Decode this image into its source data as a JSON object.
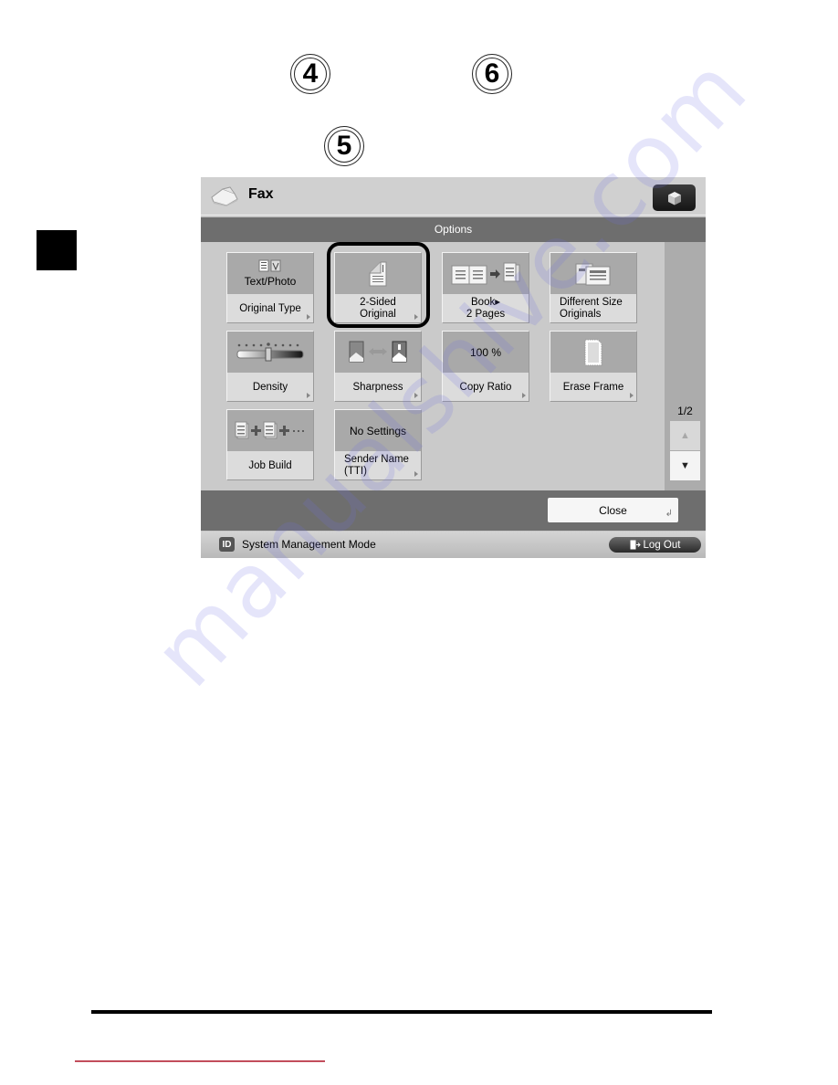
{
  "callouts": [
    "4",
    "5",
    "6"
  ],
  "screen": {
    "app_title": "Fax",
    "top_button_icon": "cube-icon",
    "section_title": "Options",
    "cards": [
      {
        "value": "Text/Photo",
        "label": "Original Type",
        "icon": "text-photo-icon",
        "has_arrow": true
      },
      {
        "value": "",
        "label": "2-Sided\nOriginal",
        "icon": "two-sided-original-icon",
        "has_arrow": true,
        "highlighted": true
      },
      {
        "value": "",
        "label": "Book▸\n2 Pages",
        "icon": "book-to-pages-icon",
        "has_arrow": false
      },
      {
        "value": "",
        "label": "Different Size\nOriginals",
        "icon": "different-size-originals-icon",
        "has_arrow": false
      },
      {
        "value": "",
        "label": "Density",
        "icon": "density-slider-icon",
        "has_arrow": true
      },
      {
        "value": "",
        "label": "Sharpness",
        "icon": "sharpness-icon",
        "has_arrow": true
      },
      {
        "value": "100 %",
        "label": "Copy Ratio",
        "icon": "",
        "has_arrow": true
      },
      {
        "value": "",
        "label": "Erase Frame",
        "icon": "erase-frame-icon",
        "has_arrow": true
      },
      {
        "value": "",
        "label": "Job Build",
        "icon": "job-build-icon",
        "has_arrow": false
      },
      {
        "value": "No Settings",
        "label": "Sender Name\n(TTI)",
        "icon": "",
        "has_arrow": true
      }
    ],
    "pager": {
      "text": "1/2",
      "up_label": "▲",
      "down_label": "▼"
    },
    "close_label": "Close",
    "close_enter_glyph": "↲",
    "status": {
      "badge": "ID",
      "text": "System Management Mode",
      "logout_label": "Log Out"
    }
  },
  "watermark": "manualshive.com"
}
